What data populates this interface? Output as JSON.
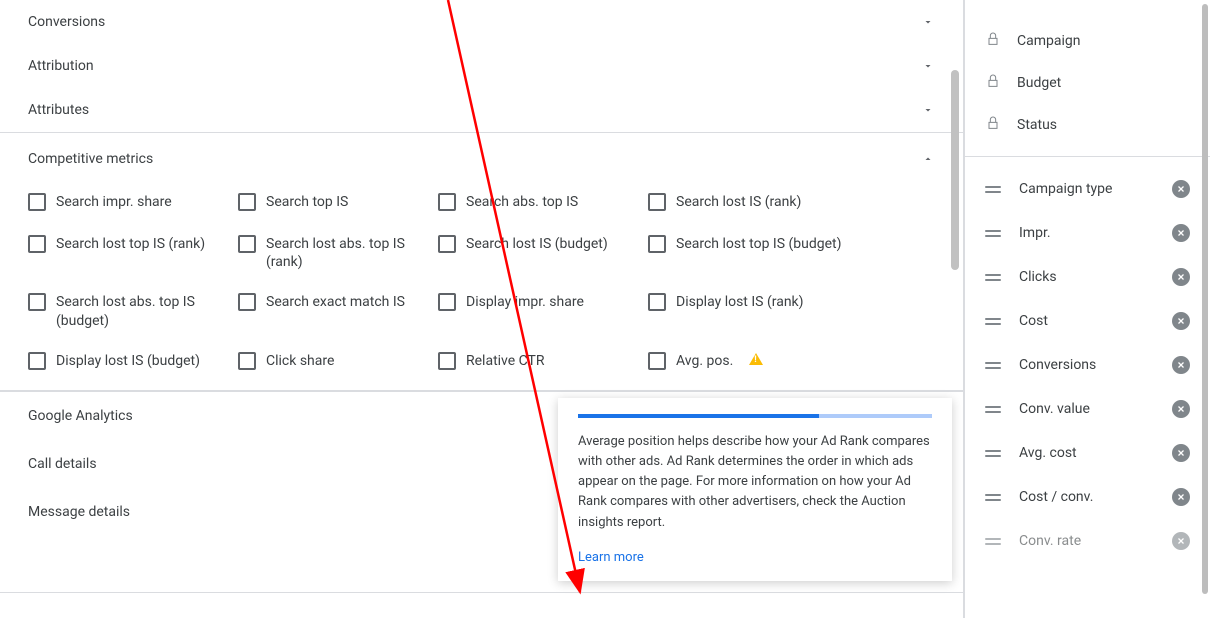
{
  "sections": {
    "conversions": "Conversions",
    "attribution": "Attribution",
    "attributes": "Attributes",
    "competitive": "Competitive metrics",
    "google_analytics": "Google Analytics",
    "call_details": "Call details",
    "message_details": "Message details"
  },
  "competitive_items": [
    "Search impr. share",
    "Search top IS",
    "Search abs. top IS",
    "Search lost IS (rank)",
    "Search lost top IS (rank)",
    "Search lost abs. top IS (rank)",
    "Search lost IS (budget)",
    "Search lost top IS (budget)",
    "Search lost abs. top IS (budget)",
    "Search exact match IS",
    "Display impr. share",
    "Display lost IS (rank)",
    "Display lost IS (budget)",
    "Click share",
    "Relative CTR",
    "Avg. pos."
  ],
  "tooltip": {
    "body": "Average position helps describe how your Ad Rank compares with other ads. Ad Rank determines the order in which ads appear on the page. For more information on how your Ad Rank compares with other advertisers, check the Auction insights report.",
    "link": "Learn more"
  },
  "right_panel": {
    "locked": [
      "Campaign",
      "Budget",
      "Status"
    ],
    "draggable": [
      "Campaign type",
      "Impr.",
      "Clicks",
      "Cost",
      "Conversions",
      "Conv. value",
      "Avg. cost",
      "Cost / conv.",
      "Conv. rate"
    ]
  }
}
